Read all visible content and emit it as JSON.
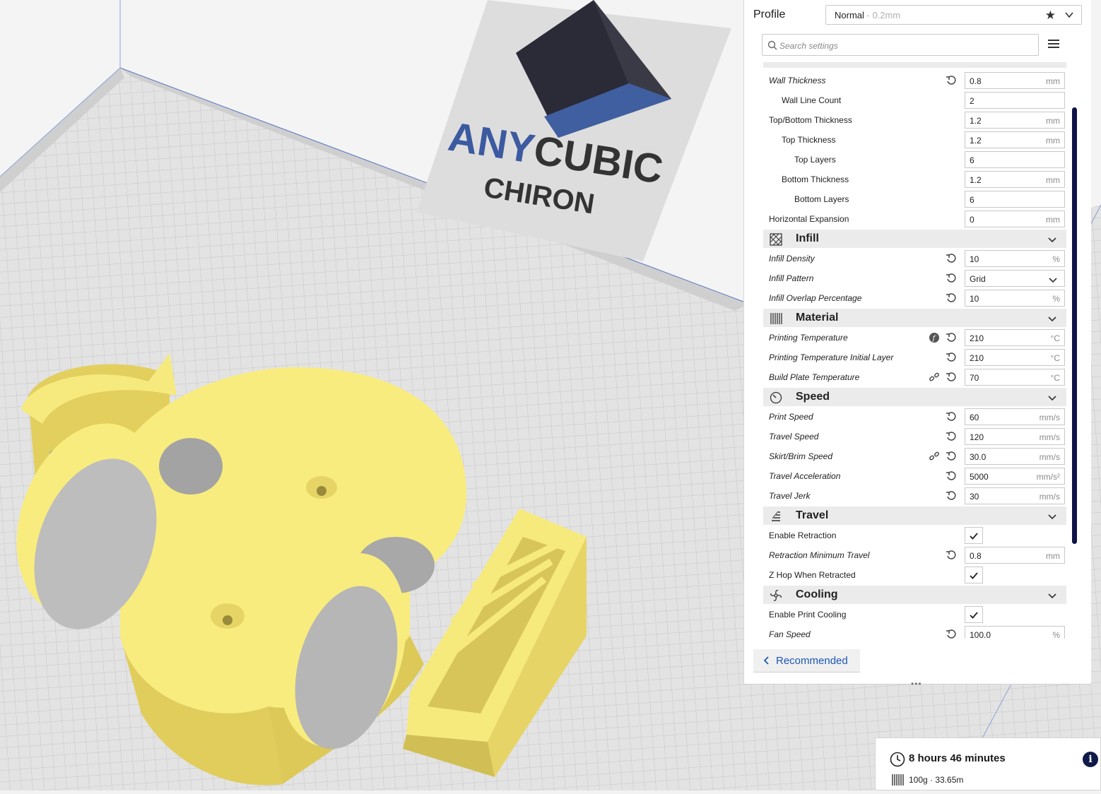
{
  "viewport": {
    "printer_logo_top": "ANYCUBIC",
    "printer_logo_any": "ANY",
    "printer_logo_cubic": "CUBIC",
    "printer_logo_bottom": "CHIRON",
    "colors": {
      "model": "#f7eb7a",
      "model_side": "#d9c95a",
      "plate": "#e6e6e6",
      "grid": "#c8c8c8",
      "cube_dark": "#2a2a36",
      "cube_blue": "#3e5f9e"
    }
  },
  "profile": {
    "label": "Profile",
    "name": "Normal",
    "layer": " - 0.2mm"
  },
  "search": {
    "placeholder": "Search settings"
  },
  "settings": [
    {
      "type": "row",
      "label": "Wall Thickness",
      "italic": true,
      "indent": 0,
      "reset": true,
      "value": "0.8",
      "unit": "mm"
    },
    {
      "type": "row",
      "label": "Wall Line Count",
      "italic": false,
      "indent": 1,
      "value": "2",
      "unit": ""
    },
    {
      "type": "row",
      "label": "Top/Bottom Thickness",
      "italic": false,
      "indent": 0,
      "value": "1.2",
      "unit": "mm"
    },
    {
      "type": "row",
      "label": "Top Thickness",
      "italic": false,
      "indent": 1,
      "value": "1.2",
      "unit": "mm"
    },
    {
      "type": "row",
      "label": "Top Layers",
      "italic": false,
      "indent": 2,
      "value": "6",
      "unit": ""
    },
    {
      "type": "row",
      "label": "Bottom Thickness",
      "italic": false,
      "indent": 1,
      "value": "1.2",
      "unit": "mm"
    },
    {
      "type": "row",
      "label": "Bottom Layers",
      "italic": false,
      "indent": 2,
      "value": "6",
      "unit": ""
    },
    {
      "type": "row",
      "label": "Horizontal Expansion",
      "italic": false,
      "indent": 0,
      "value": "0",
      "unit": "mm"
    },
    {
      "type": "category",
      "label": "Infill",
      "icon": "infill-icon"
    },
    {
      "type": "row",
      "label": "Infill Density",
      "italic": true,
      "indent": 0,
      "reset": true,
      "value": "10",
      "unit": "%"
    },
    {
      "type": "row",
      "label": "Infill Pattern",
      "italic": true,
      "indent": 0,
      "reset": true,
      "value": "Grid",
      "dropdown": true
    },
    {
      "type": "row",
      "label": "Infill Overlap Percentage",
      "italic": true,
      "indent": 0,
      "reset": true,
      "value": "10",
      "unit": "%"
    },
    {
      "type": "category",
      "label": "Material",
      "icon": "material-icon"
    },
    {
      "type": "row",
      "label": "Printing Temperature",
      "italic": true,
      "indent": 0,
      "reset": true,
      "extra": "function-icon",
      "value": "210",
      "unit": "°C"
    },
    {
      "type": "row",
      "label": "Printing Temperature Initial Layer",
      "italic": true,
      "indent": 0,
      "reset": true,
      "value": "210",
      "unit": "°C"
    },
    {
      "type": "row",
      "label": "Build Plate Temperature",
      "italic": true,
      "indent": 0,
      "reset": true,
      "extra": "link-icon",
      "value": "70",
      "unit": "°C"
    },
    {
      "type": "category",
      "label": "Speed",
      "icon": "speed-icon"
    },
    {
      "type": "row",
      "label": "Print Speed",
      "italic": true,
      "indent": 0,
      "reset": true,
      "value": "60",
      "unit": "mm/s"
    },
    {
      "type": "row",
      "label": "Travel Speed",
      "italic": true,
      "indent": 0,
      "reset": true,
      "value": "120",
      "unit": "mm/s"
    },
    {
      "type": "row",
      "label": "Skirt/Brim Speed",
      "italic": true,
      "indent": 0,
      "reset": true,
      "extra": "link-icon",
      "value": "30.0",
      "unit": "mm/s"
    },
    {
      "type": "row",
      "label": "Travel Acceleration",
      "italic": true,
      "indent": 0,
      "reset": true,
      "value": "5000",
      "unit": "mm/s²"
    },
    {
      "type": "row",
      "label": "Travel Jerk",
      "italic": true,
      "indent": 0,
      "reset": true,
      "value": "30",
      "unit": "mm/s"
    },
    {
      "type": "category",
      "label": "Travel",
      "icon": "travel-icon"
    },
    {
      "type": "row",
      "label": "Enable Retraction",
      "italic": false,
      "indent": 0,
      "checkbox": true,
      "checked": true
    },
    {
      "type": "row",
      "label": "Retraction Minimum Travel",
      "italic": true,
      "indent": 0,
      "reset": true,
      "value": "0.8",
      "unit": "mm"
    },
    {
      "type": "row",
      "label": "Z Hop When Retracted",
      "italic": false,
      "indent": 0,
      "checkbox": true,
      "checked": true
    },
    {
      "type": "category",
      "label": "Cooling",
      "icon": "cooling-icon"
    },
    {
      "type": "row",
      "label": "Enable Print Cooling",
      "italic": false,
      "indent": 0,
      "checkbox": true,
      "checked": true
    },
    {
      "type": "row",
      "label": "Fan Speed",
      "italic": true,
      "indent": 0,
      "reset": true,
      "value": "100.0",
      "unit": "%"
    }
  ],
  "footer": {
    "recommended_label": "Recommended",
    "grip": "•••"
  },
  "estimate": {
    "time": "8 hours 46 minutes",
    "material": "100g · 33.65m",
    "info": "i"
  },
  "colors": {
    "accent": "#1c56b8",
    "scrollbar": "#0e1448"
  }
}
